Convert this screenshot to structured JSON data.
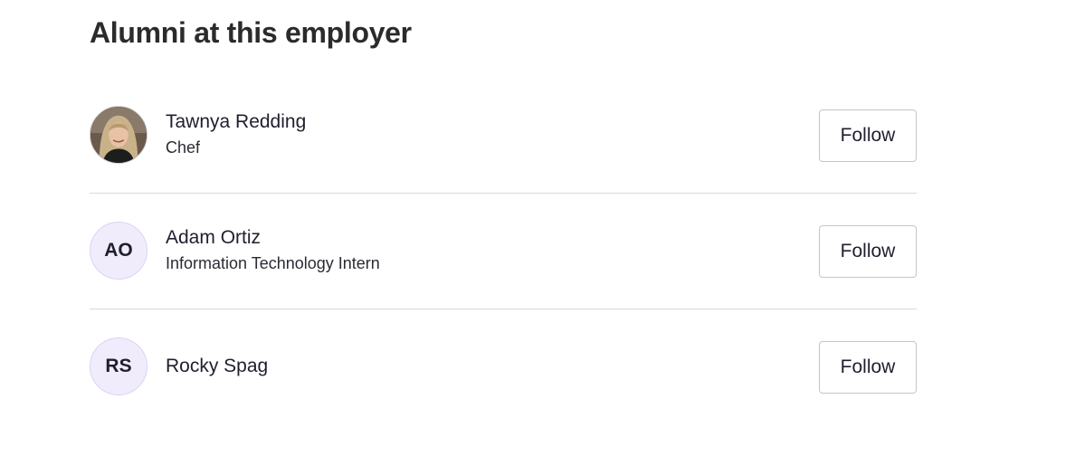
{
  "section": {
    "heading": "Alumni at this employer"
  },
  "alumni": [
    {
      "name": "Tawnya Redding",
      "title": "Chef",
      "initials": "",
      "avatar_type": "photo"
    },
    {
      "name": "Adam Ortiz",
      "title": "Information Technology Intern",
      "initials": "AO",
      "avatar_type": "initials"
    },
    {
      "name": "Rocky Spag",
      "title": "",
      "initials": "RS",
      "avatar_type": "initials"
    }
  ],
  "actions": {
    "follow_label": "Follow"
  },
  "colors": {
    "avatar_bg": "#f1ecfc",
    "divider": "#d8d8e0",
    "button_border": "#c4c4cc"
  }
}
